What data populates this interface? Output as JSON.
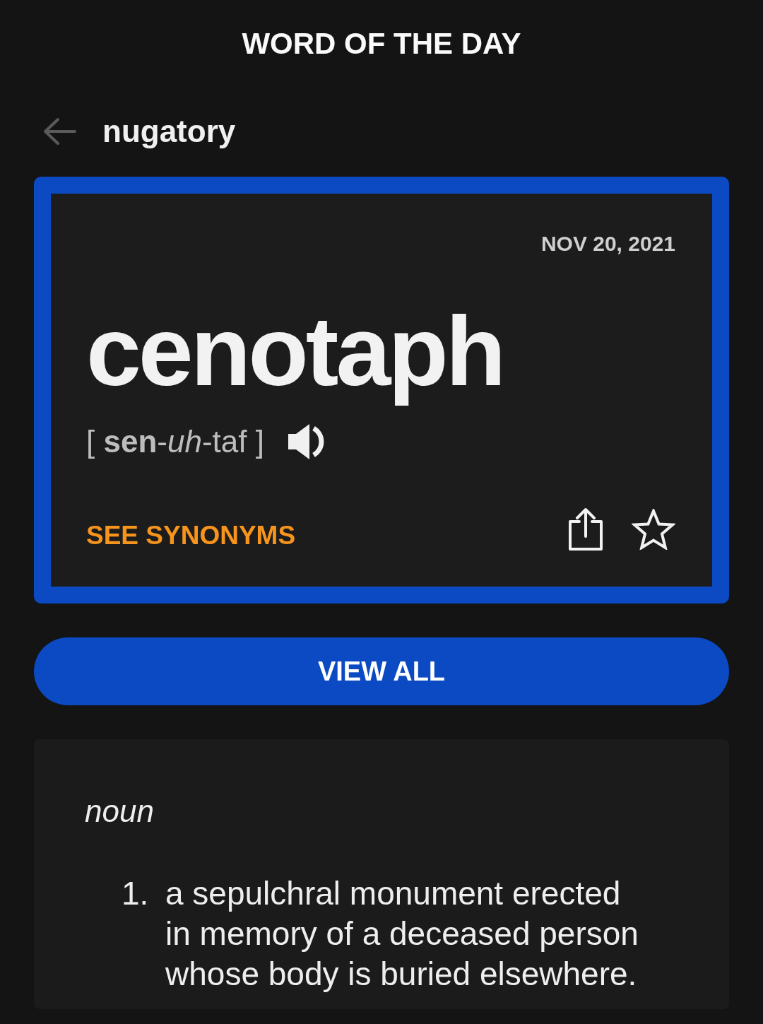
{
  "header": {
    "title": "WORD OF THE DAY"
  },
  "nav": {
    "word": "nugatory"
  },
  "word_card": {
    "date": "NOV 20, 2021",
    "word": "cenotaph",
    "pronunciation": "[ **sen**-*uh*-taf ]",
    "synonyms_link": "SEE SYNONYMS"
  },
  "view_all_button": {
    "label": "VIEW ALL"
  },
  "definition": {
    "part_of_speech": "noun",
    "senses": [
      {
        "number": "1.",
        "text": "a sepulchral monument erected in memory of a deceased person whose body is buried elsewhere."
      }
    ]
  }
}
